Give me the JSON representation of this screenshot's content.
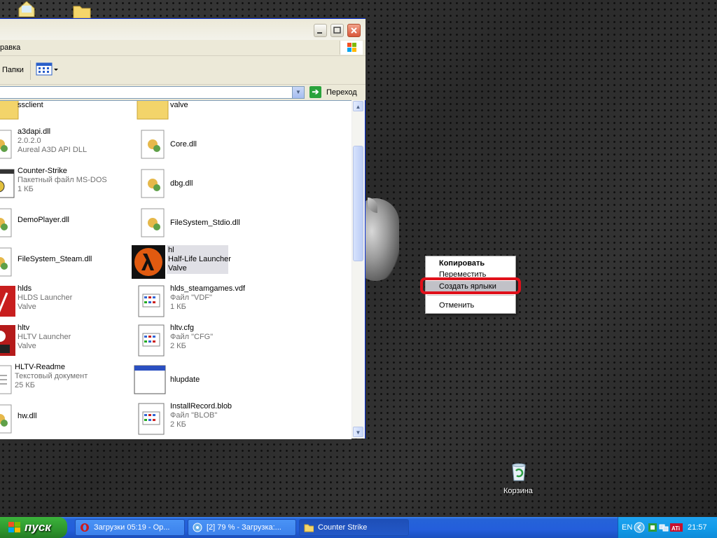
{
  "window": {
    "menu_partial": "равка",
    "toolbar": {
      "folders_label": "Папки"
    },
    "address": {
      "go_label": "Переход"
    }
  },
  "files_col1": [
    {
      "name": "ssclient",
      "sub1": "",
      "sub2": "",
      "icon": "folder-icon"
    },
    {
      "name": "a3dapi.dll",
      "sub1": "2.0.2.0",
      "sub2": "Aureal A3D API DLL",
      "icon": "dll-icon"
    },
    {
      "name": "Counter-Strike",
      "sub1": "Пакетный файл MS-DOS",
      "sub2": "1 КБ",
      "icon": "batch-file-icon"
    },
    {
      "name": "DemoPlayer.dll",
      "sub1": "",
      "sub2": "",
      "icon": "dll-icon"
    },
    {
      "name": "FileSystem_Steam.dll",
      "sub1": "",
      "sub2": "",
      "icon": "dll-icon"
    },
    {
      "name": "hlds",
      "sub1": "HLDS Launcher",
      "sub2": "Valve",
      "icon": "hlds-icon"
    },
    {
      "name": "hltv",
      "sub1": "HLTV Launcher",
      "sub2": "Valve",
      "icon": "hltv-icon"
    },
    {
      "name": "HLTV-Readme",
      "sub1": "Текстовый документ",
      "sub2": "25 КБ",
      "icon": "text-document-icon"
    },
    {
      "name": "hw.dll",
      "sub1": "",
      "sub2": "",
      "icon": "dll-icon"
    }
  ],
  "files_col2": [
    {
      "name": "valve",
      "sub1": "",
      "sub2": "",
      "icon": "folder-icon"
    },
    {
      "name": "Core.dll",
      "sub1": "",
      "sub2": "",
      "icon": "dll-icon"
    },
    {
      "name": "dbg.dll",
      "sub1": "",
      "sub2": "",
      "icon": "dll-icon"
    },
    {
      "name": "FileSystem_Stdio.dll",
      "sub1": "",
      "sub2": "",
      "icon": "dll-icon"
    },
    {
      "name": "hl",
      "sub1": "Half-Life Launcher",
      "sub2": "Valve",
      "icon": "half-life-icon"
    },
    {
      "name": "hlds_steamgames.vdf",
      "sub1": "Файл \"VDF\"",
      "sub2": "1 КБ",
      "icon": "generic-file-icon"
    },
    {
      "name": "hltv.cfg",
      "sub1": "Файл \"CFG\"",
      "sub2": "2 КБ",
      "icon": "generic-file-icon"
    },
    {
      "name": "hlupdate",
      "sub1": "",
      "sub2": "",
      "icon": "application-window-icon"
    },
    {
      "name": "InstallRecord.blob",
      "sub1": "Файл \"BLOB\"",
      "sub2": "2 КБ",
      "icon": "generic-file-icon"
    }
  ],
  "context_menu": {
    "copy": "Копировать",
    "move": "Переместить",
    "create_shortcuts": "Создать ярлыки",
    "cancel": "Отменить"
  },
  "desktop": {
    "recycle_bin_label": "Корзина"
  },
  "taskbar": {
    "start_label": "пуск",
    "buttons": [
      {
        "label": "Загрузки 05:19 - Ор..."
      },
      {
        "label": "[2] 79 % - Загрузка:..."
      },
      {
        "label": "Counter Strike"
      }
    ],
    "tray": {
      "lang": "EN",
      "clock": "21:57"
    }
  },
  "colors": {
    "highlight_ring": "#e0101a",
    "xp_blue": "#245edb",
    "start_green": "#2e962e"
  }
}
